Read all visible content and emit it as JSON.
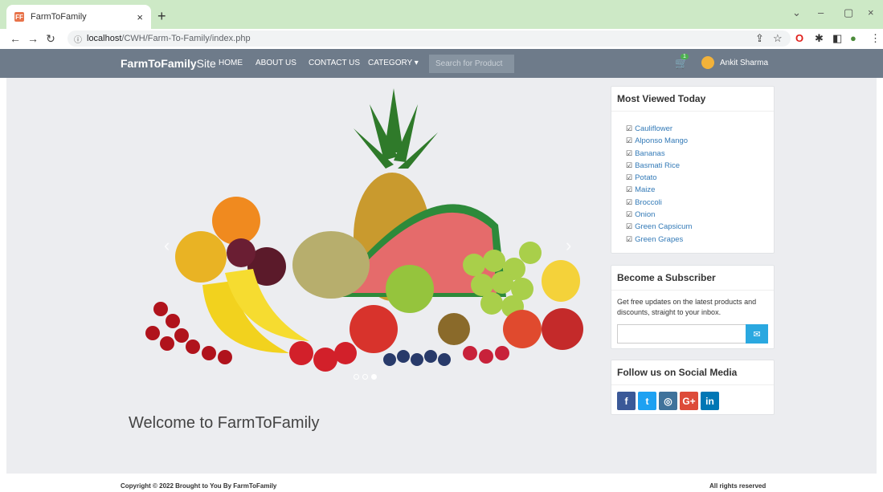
{
  "browser": {
    "tab_title": "FarmToFamily",
    "favicon_text": "FF",
    "url_host": "localhost",
    "url_path": "/CWH/Farm-To-Family/index.php"
  },
  "navbar": {
    "brand_bold": "FarmToFamily",
    "brand_light": "Site",
    "links": [
      "HOME",
      "ABOUT US",
      "CONTACT US",
      "CATEGORY"
    ],
    "search_placeholder": "Search for Product",
    "cart_count": "1",
    "user_name": "Ankit Sharma"
  },
  "carousel": {
    "prev": "‹",
    "next": "›"
  },
  "welcome_text": "Welcome to FarmToFamily",
  "most_viewed": {
    "title": "Most Viewed Today",
    "items": [
      "Cauliflower",
      "Alponso Mango",
      "Bananas",
      "Basmati Rice",
      "Potato",
      "Maize",
      "Broccoli",
      "Onion",
      "Green Capsicum",
      "Green Grapes"
    ]
  },
  "subscriber": {
    "title": "Become a Subscriber",
    "text": "Get free updates on the latest products and discounts, straight to your inbox."
  },
  "social": {
    "title": "Follow us on Social Media",
    "icons": [
      {
        "label": "f",
        "color": "#3b5998"
      },
      {
        "label": "t",
        "color": "#1da1f2"
      },
      {
        "label": "◎",
        "color": "#3f729b"
      },
      {
        "label": "G+",
        "color": "#dd4b39"
      },
      {
        "label": "in",
        "color": "#0077b5"
      }
    ]
  },
  "footer": {
    "left": "Copyright © 2022 Brought to You By FarmToFamily",
    "right": "All rights reserved"
  }
}
